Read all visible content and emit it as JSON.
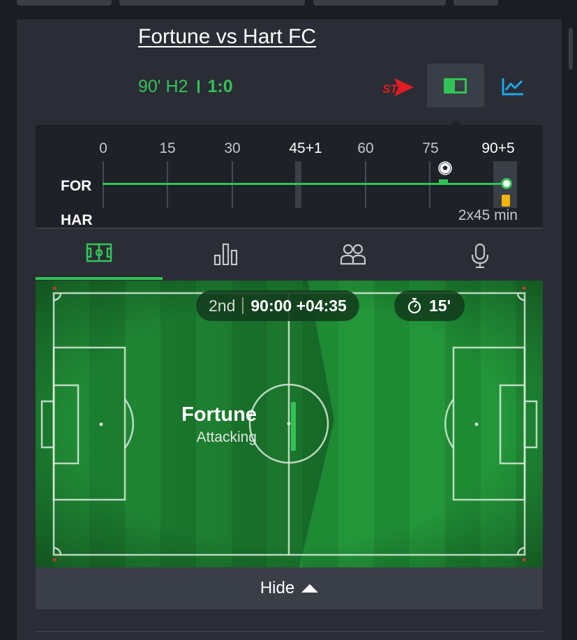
{
  "match": {
    "title": "Fortune vs Hart FC",
    "minute": "90' H2",
    "score": "1:0"
  },
  "toolbar": {
    "stream_icon": "stv-logo",
    "field_view_icon": "pitch-icon",
    "stats_icon": "line-chart-icon"
  },
  "timeline": {
    "ticks": [
      "0",
      "15",
      "30",
      "45+1",
      "60",
      "75",
      "90+5"
    ],
    "home_short": "FOR",
    "away_short": "HAR",
    "duration": "2x45 min",
    "progress": 1.0,
    "events": [
      {
        "type": "goal",
        "team": "home",
        "icon": "soccer-ball-icon"
      },
      {
        "type": "yellow-card",
        "team": "away",
        "color": "#f4b400"
      }
    ]
  },
  "tabs": [
    {
      "icon": "pitch-icon",
      "active": true
    },
    {
      "icon": "bar-chart-icon",
      "active": false
    },
    {
      "icon": "lineup-icon",
      "active": false
    },
    {
      "icon": "microphone-icon",
      "active": false
    }
  ],
  "pitch": {
    "period": "2nd",
    "clock": "90:00 +04:35",
    "timer": "15'",
    "team": "Fortune",
    "status": "Attacking"
  },
  "footer": {
    "hide_label": "Hide"
  },
  "colors": {
    "accent": "#32c356",
    "panel": "#2a2d35",
    "background": "#1a1d24",
    "stv_red": "#e31b23",
    "chart_blue": "#1ea7e8",
    "card_yellow": "#f4b400"
  }
}
